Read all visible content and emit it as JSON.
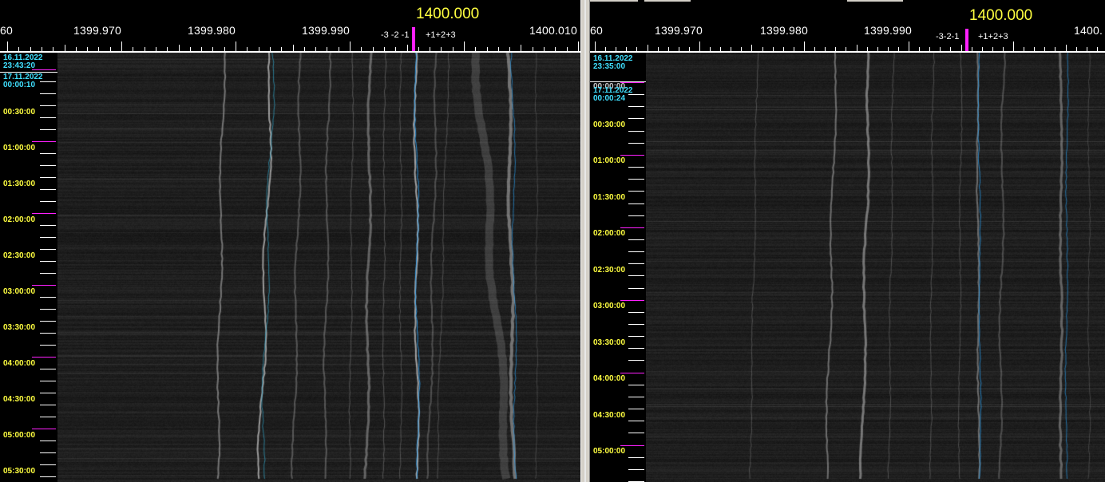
{
  "left": {
    "center_label": "1400.000",
    "offsets_label": "-3 -2 -1",
    "offsets_label_pos": "+1+2+3",
    "freq_labels": [
      "60",
      "1399.970",
      "1399.980",
      "1399.990",
      "1400.010"
    ],
    "dates": [
      {
        "date": "16.11.2022",
        "time": "23:43:20"
      },
      {
        "date": "17.11.2022",
        "time": "00:00:10"
      }
    ],
    "time_labels": [
      "00:30:00",
      "01:00:00",
      "01:30:00",
      "02:00:00",
      "02:30:00",
      "03:00:00",
      "03:30:00",
      "04:00:00",
      "04:30:00",
      "05:00:00",
      "05:30:00"
    ]
  },
  "right": {
    "center_label": "1400.000",
    "offsets_label": "-3-2-1",
    "offsets_label_pos": "+1+2+3",
    "freq_labels": [
      "60",
      "1399.970",
      "1399.980",
      "1399.990",
      "1400."
    ],
    "dates": [
      {
        "date": "16.11.2022",
        "time": "23:35:00"
      },
      {
        "date": "17.11.2022",
        "time": "00:00:24"
      }
    ],
    "overlap_time": "00:00:00",
    "time_labels": [
      "00:30:00",
      "01:00:00",
      "01:30:00",
      "02:00:00",
      "02:30:00",
      "03:00:00",
      "03:30:00",
      "04:00:00",
      "04:30:00",
      "05:00:00"
    ]
  },
  "colors": {
    "time_label": "#ffff40",
    "date_label": "#40e0ff",
    "center_label": "#ffff40",
    "marker": "#ff20ff",
    "scale": "#ffffff"
  }
}
